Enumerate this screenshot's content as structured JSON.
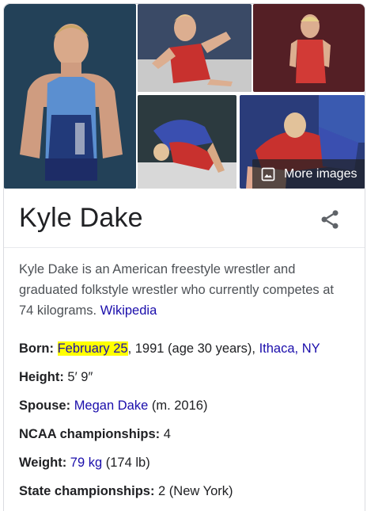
{
  "entity": {
    "name": "Kyle Dake",
    "description": "Kyle Dake is an American freestyle wrestler and graduated folkstyle wrestler who currently competes at 74 kilograms.",
    "source_link": "Wikipedia"
  },
  "gallery": {
    "more_images_label": "More images",
    "images": [
      "wrestler-portrait",
      "wrestler-celebrating",
      "wrestler-red-singlet",
      "wrestling-throw",
      "wrestling-match"
    ]
  },
  "facts": {
    "born": {
      "label": "Born:",
      "date_highlight": "February 25",
      "rest": ", 1991 (age 30 years), ",
      "place": "Ithaca, NY"
    },
    "height": {
      "label": "Height:",
      "value": "5′ 9″"
    },
    "spouse": {
      "label": "Spouse:",
      "link": "Megan Dake",
      "rest": " (m. 2016)"
    },
    "ncaa": {
      "label": "NCAA championships:",
      "value": "4"
    },
    "weight": {
      "label": "Weight:",
      "link": "79 kg",
      "rest": " (174 lb)"
    },
    "state": {
      "label": "State championships:",
      "value": "2 (New York)"
    }
  },
  "colors": {
    "link": "#1a0dab",
    "highlight": "#ffff00",
    "text": "#202124",
    "secondary_text": "#4d5156"
  }
}
